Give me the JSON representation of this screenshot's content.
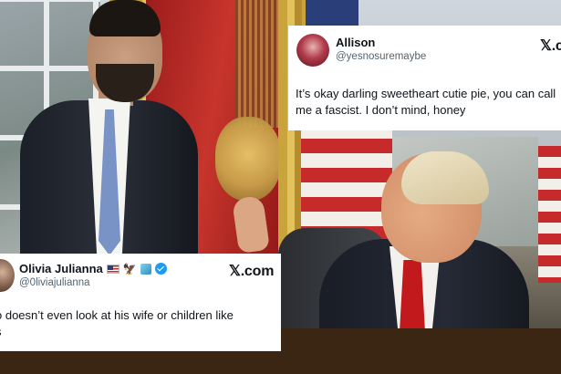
{
  "tweets": {
    "top": {
      "display_name": "Allison",
      "handle": "@yesnosuremaybe",
      "text_line1": "It’s okay darling sweetheart cutie pie, you can call",
      "text_line2": "me a fascist. I don’t mind, honey",
      "brand": "𝕏.com"
    },
    "bottom": {
      "display_name": "Olivia Julianna",
      "handle": "@0liviajulianna",
      "text_line1": "o doesn’t even look at his wife or children like",
      "text_line2": "s",
      "brand": "𝕏.com"
    }
  },
  "icons": {
    "top_avatar": "avatar-photo",
    "bottom_avatar": "avatar-photo",
    "bottom_badges": [
      "us-flag-emoji",
      "eagle-emoji",
      "cube-emoji",
      "verified-badge-icon"
    ]
  },
  "colors": {
    "verified_blue": "#1d9bf0",
    "handle_gray": "#536471",
    "card_bg": "#ffffff",
    "text": "#0f1419"
  }
}
